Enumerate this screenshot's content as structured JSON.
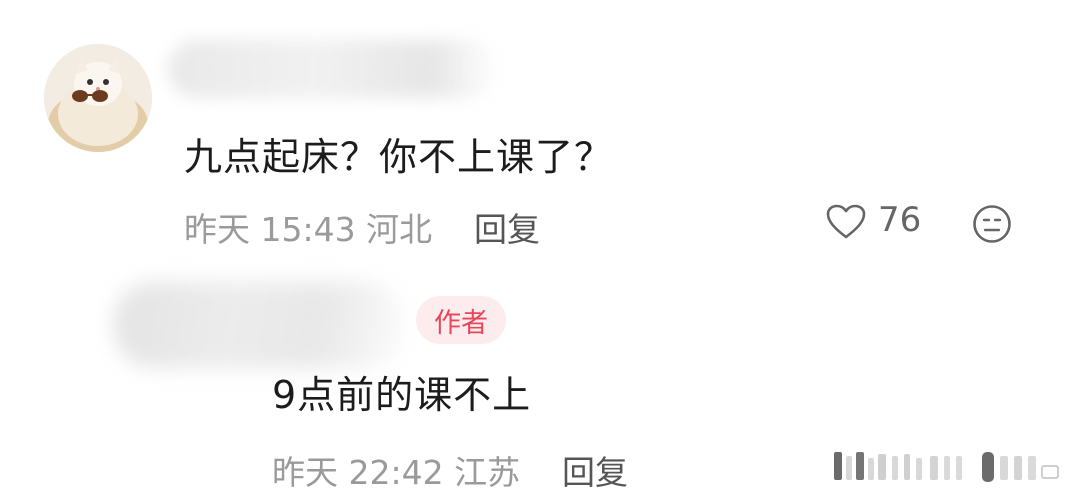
{
  "comment": {
    "text": "九点起床？你不上课了？",
    "time": "昨天 15:43",
    "location": "河北",
    "reply_label": "回复",
    "likes": "76",
    "avatar_icon": "cat-with-sunglasses-avatar",
    "like_icon": "heart-outline-icon",
    "dislike_icon": "meh-face-icon"
  },
  "reply": {
    "badge": "作者",
    "text": "9点前的课不上",
    "time": "昨天 22:42",
    "location": "江苏",
    "reply_label": "回复"
  },
  "colors": {
    "badge_text": "#e8475a",
    "badge_bg": "#fdecee",
    "meta": "#9a9a9a"
  }
}
